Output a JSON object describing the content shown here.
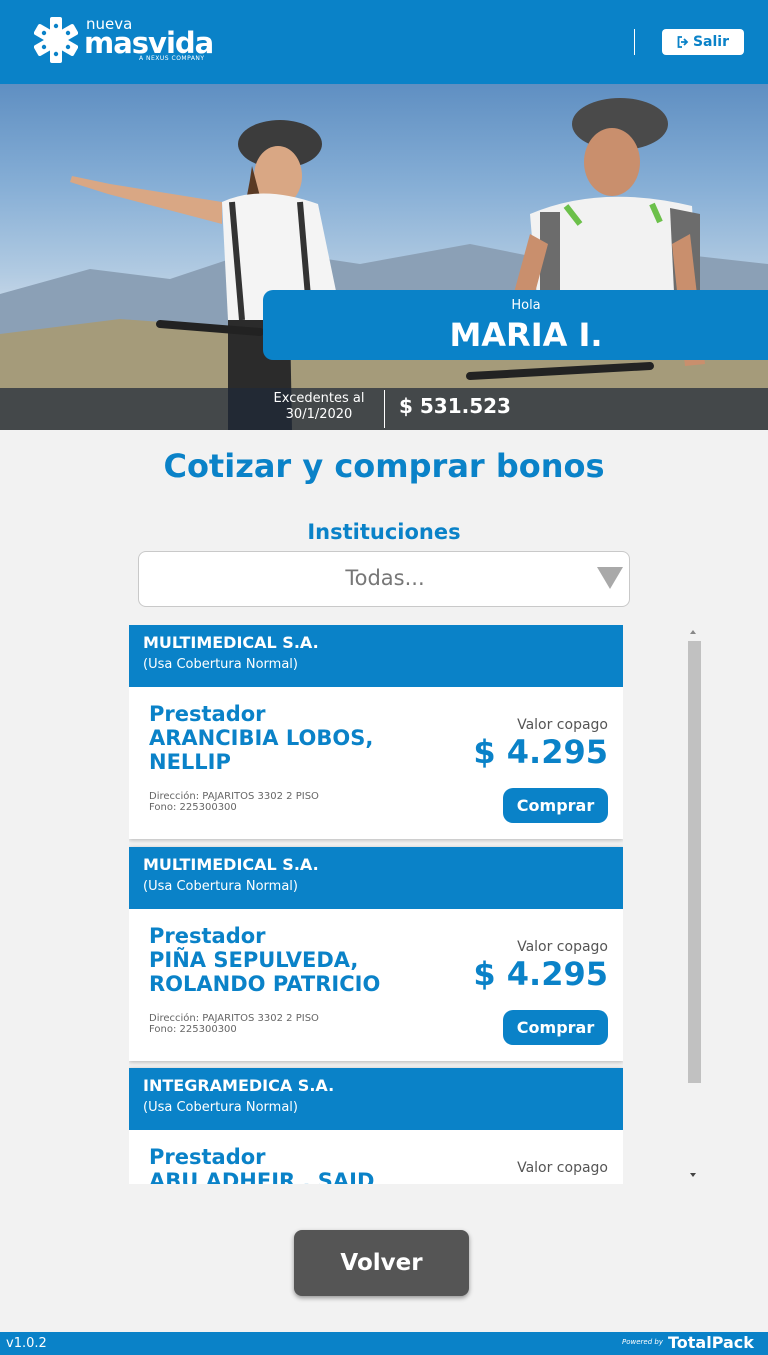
{
  "header": {
    "logo_small": "nueva",
    "logo_big": "masvida",
    "logo_tag": "A NEXUS COMPANY",
    "logout_label": "Salir",
    "logo_icon": "star-of-life-icon",
    "logout_icon": "sign-out-icon"
  },
  "hero": {
    "greeting": "Hola",
    "user_name": "MARIA I.",
    "excess_label": "Excedentes al 30/1/2020",
    "excess_value": "$ 531.523"
  },
  "main": {
    "title": "Cotizar y comprar bonos",
    "institutions_label": "Instituciones",
    "institutions_selected": "Todas..."
  },
  "providers": [
    {
      "institution": "MULTIMEDICAL S.A.",
      "coverage": "(Usa Cobertura Normal)",
      "role": "Prestador",
      "name": "ARANCIBIA LOBOS, NELLIP",
      "address": "Dirección: PAJARITOS 3302 2 PISO",
      "phone": "Fono: 225300300",
      "copay_label": "Valor copago",
      "copay_value": "$ 4.295",
      "buy_label": "Comprar"
    },
    {
      "institution": "MULTIMEDICAL S.A.",
      "coverage": "(Usa Cobertura Normal)",
      "role": "Prestador",
      "name": "PIÑA SEPULVEDA, ROLANDO PATRICIO",
      "address": "Dirección: PAJARITOS 3302 2 PISO",
      "phone": "Fono: 225300300",
      "copay_label": "Valor copago",
      "copay_value": "$ 4.295",
      "buy_label": "Comprar"
    },
    {
      "institution": "INTEGRAMEDICA S.A.",
      "coverage": "(Usa Cobertura Normal)",
      "role": "Prestador",
      "name": "ABU ADHEIR , SAID",
      "address": "",
      "phone": "",
      "copay_label": "Valor copago",
      "copay_value": "",
      "buy_label": ""
    }
  ],
  "back_label": "Volver",
  "footer": {
    "version": "v1.0.2",
    "powered_by": "Powered by",
    "brand": "TotalPack"
  },
  "colors": {
    "primary": "#0a82c8",
    "background": "#f2f2f2",
    "back_button": "#555555"
  }
}
